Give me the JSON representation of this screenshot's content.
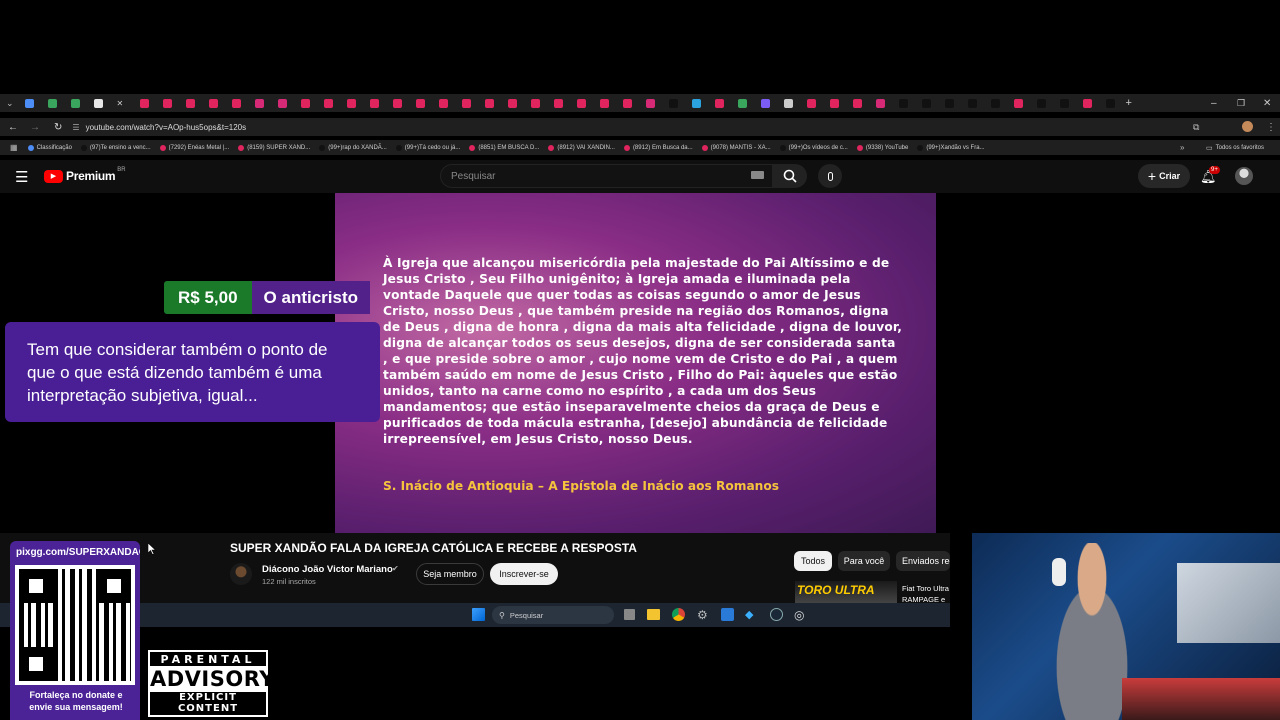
{
  "browser": {
    "url": "youtube.com/watch?v=AOp-hus5ops&t=120s",
    "all_bookmarks_label": "Todos os favoritos",
    "tab_colors": [
      "#4c8df6",
      "#3aa55c",
      "#3aa55c",
      "#e8e8e8",
      "#cccccc",
      "#e0245e",
      "#e0245e",
      "#e0245e",
      "#e0245e",
      "#e0245e",
      "#d62976",
      "#d62976",
      "#e0245e",
      "#e0245e",
      "#e0245e",
      "#e0245e",
      "#e0245e",
      "#e0245e",
      "#e0245e",
      "#e0245e",
      "#e0245e",
      "#e0245e",
      "#e0245e",
      "#e0245e",
      "#e0245e",
      "#e0245e",
      "#e0245e",
      "#d62976",
      "#111111",
      "#2aa3df",
      "#e0245e",
      "#3aa55c",
      "#7b5cf5",
      "#cccccc",
      "#e0245e",
      "#e0245e",
      "#e0245e",
      "#d62976",
      "#111111",
      "#111111",
      "#111111",
      "#111111",
      "#111111",
      "#e0245e",
      "#111111",
      "#111111",
      "#e0245e",
      "#111111"
    ],
    "bookmarks": [
      {
        "label": "Classificação",
        "color": "#4c8df6"
      },
      {
        "label": "(97)Te ensino a venc...",
        "color": "#111111"
      },
      {
        "label": "(7292) Enéas Metal |...",
        "color": "#e0245e"
      },
      {
        "label": "(8159) SUPER XAND...",
        "color": "#e0245e"
      },
      {
        "label": "(99+)rap do XANDÃ...",
        "color": "#111111"
      },
      {
        "label": "(99+)Tá cedo ou já...",
        "color": "#111111"
      },
      {
        "label": "(8851) EM BUSCA D...",
        "color": "#e0245e"
      },
      {
        "label": "(8912) VAI XANDIN...",
        "color": "#e0245e"
      },
      {
        "label": "(8912) Em Busca da...",
        "color": "#e0245e"
      },
      {
        "label": "(9078) MANTIS - XA...",
        "color": "#e0245e"
      },
      {
        "label": "(99+)Os vídeos de c...",
        "color": "#111111"
      },
      {
        "label": "(9338) YouTube",
        "color": "#e0245e"
      },
      {
        "label": "(99+)Xandão vs Fra...",
        "color": "#111111"
      }
    ]
  },
  "youtube": {
    "logo_label": "Premium",
    "logo_region": "BR",
    "search_placeholder": "Pesquisar",
    "create_label": "Criar",
    "notification_count": "9+",
    "video_title": "SUPER XANDÃO FALA DA IGREJA CATÓLICA E RECEBE A RESPOSTA",
    "channel_name": "Diácono João Victor Mariano",
    "subscribers": "122 mil inscritos",
    "join_label": "Seja membro",
    "subscribe_label": "Inscrever-se",
    "filter_chips": [
      "Todos",
      "Para você",
      "Enviados rec"
    ],
    "suggested_thumb_text": "TORO ULTRA",
    "suggested_title": "Fiat Toro Ultra RAMPAGE e"
  },
  "video_frame": {
    "quote": "À Igreja que alcançou misericórdia pela majestade do Pai Altíssimo e de Jesus Cristo , Seu Filho unigênito; à Igreja amada e iluminada pela vontade Daquele que quer todas as coisas segundo o amor de Jesus Cristo, nosso Deus , que também preside na região dos Romanos, digna de Deus , digna de honra , digna da mais alta felicidade , digna de louvor, digna de alcançar todos os seus desejos, digna de ser considerada santa , e que preside sobre o amor , cujo nome vem de Cristo e do Pai , a quem também saúdo em nome de Jesus Cristo , Filho do Pai: àqueles que estão unidos, tanto na carne como no espírito , a cada um dos Seus mandamentos; que estão inseparavelmente cheios da graça de Deus e purificados de toda mácula estranha, [desejo] abundância de felicidade irrepreensível, em Jesus Cristo, nosso Deus.",
    "source": "S. Inácio de Antioquia – A Epístola de Inácio aos Romanos"
  },
  "donation": {
    "amount": "R$ 5,00",
    "name": "O anticristo",
    "message": "Tem que considerar também o ponto de que o que está dizendo também é uma interpretação subjetiva, igual..."
  },
  "qr_panel": {
    "url_text": "pixgg.com/SUPERXANDAO",
    "caption": "Fortaleça no donate e envie sua mensagem!"
  },
  "parental_advisory": {
    "line1": "PARENTAL",
    "line2": "ADVISORY",
    "line3": "EXPLICIT CONTENT"
  },
  "taskbar": {
    "search_placeholder": "Pesquisar"
  }
}
